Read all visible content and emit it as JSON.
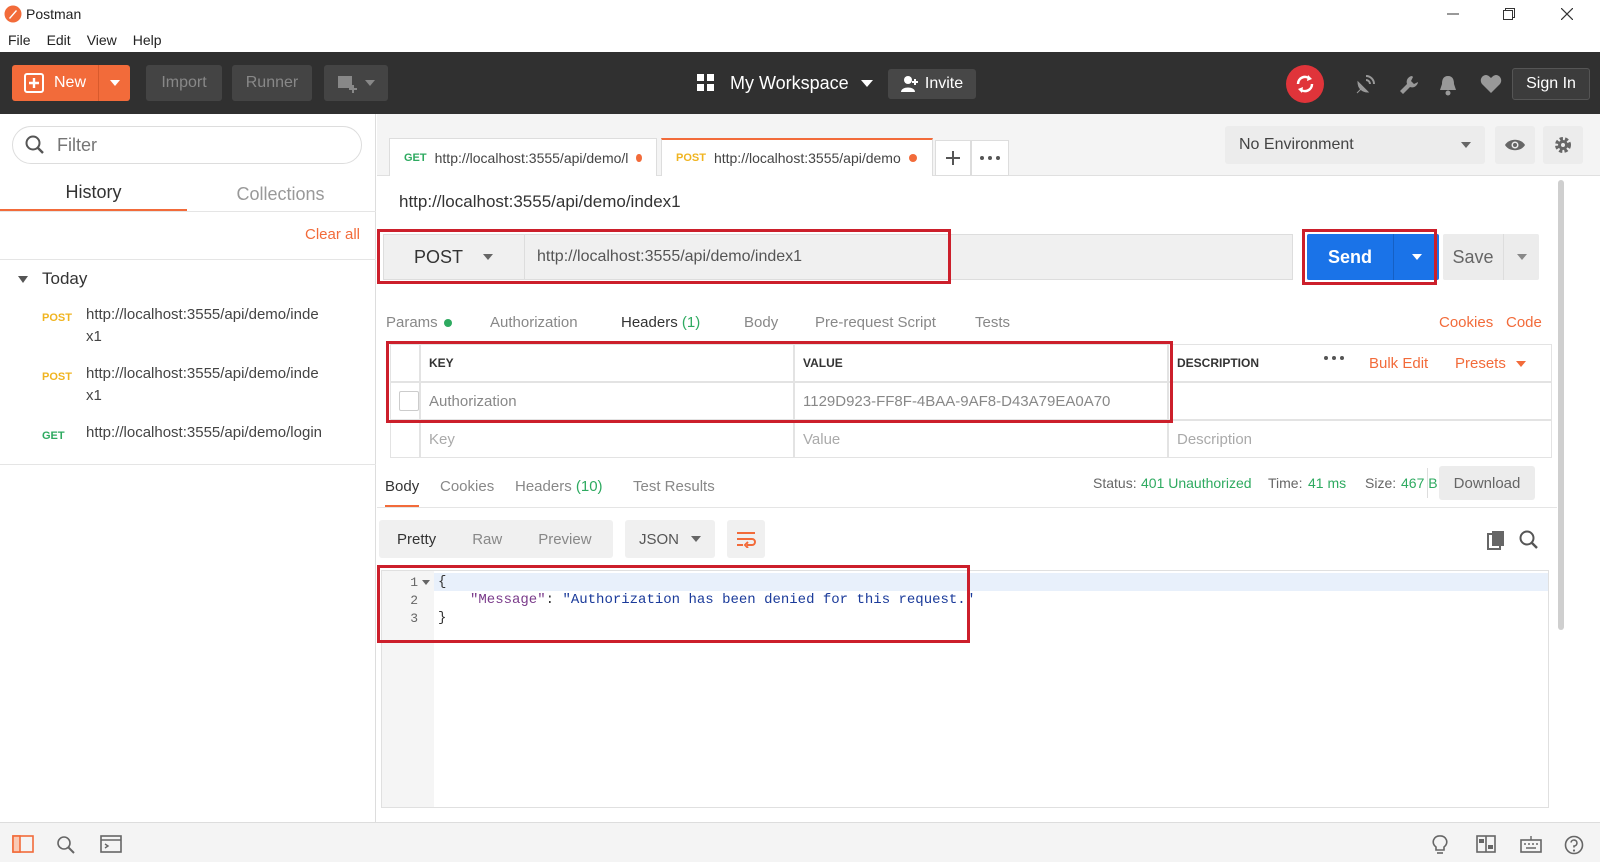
{
  "window": {
    "title": "Postman"
  },
  "menu": [
    "File",
    "Edit",
    "View",
    "Help"
  ],
  "header": {
    "new_label": "New",
    "import_label": "Import",
    "runner_label": "Runner",
    "workspace_label": "My Workspace",
    "invite_label": "Invite",
    "signin_label": "Sign In"
  },
  "sidebar": {
    "filter_placeholder": "Filter",
    "tabs": [
      "History",
      "Collections"
    ],
    "clear_all": "Clear all",
    "group_label": "Today",
    "history": [
      {
        "method": "POST",
        "url": "http://localhost:3555/api/demo/index1",
        "line1": "http://localhost:3555/api/demo/inde",
        "line2": "x1"
      },
      {
        "method": "POST",
        "url": "http://localhost:3555/api/demo/index1",
        "line1": "http://localhost:3555/api/demo/inde",
        "line2": "x1"
      },
      {
        "method": "GET",
        "url": "http://localhost:3555/api/demo/login",
        "line1": "http://localhost:3555/api/demo/login",
        "line2": ""
      }
    ]
  },
  "tabs": [
    {
      "method": "GET",
      "url": "http://localhost:3555/api/demo/l"
    },
    {
      "method": "POST",
      "url": "http://localhost:3555/api/demo"
    }
  ],
  "environment": {
    "selected": "No Environment"
  },
  "request": {
    "title": "http://localhost:3555/api/demo/index1",
    "method": "POST",
    "url": "http://localhost:3555/api/demo/index1",
    "send_label": "Send",
    "save_label": "Save",
    "subtabs": {
      "params": "Params",
      "authorization": "Authorization",
      "headers": "Headers",
      "headers_count": "(1)",
      "body": "Body",
      "prerequest": "Pre-request Script",
      "tests": "Tests"
    },
    "cookies_link": "Cookies",
    "code_link": "Code",
    "headers_table": {
      "col_key": "KEY",
      "col_value": "VALUE",
      "col_description": "DESCRIPTION",
      "bulk_edit": "Bulk Edit",
      "presets": "Presets",
      "rows": [
        {
          "key": "Authorization",
          "value": "1129D923-FF8F-4BAA-9AF8-D43A79EA0A70",
          "description": ""
        }
      ],
      "placeholder_key": "Key",
      "placeholder_value": "Value",
      "placeholder_description": "Description"
    }
  },
  "response": {
    "tabs": {
      "body": "Body",
      "cookies": "Cookies",
      "headers": "Headers",
      "headers_count": "(10)",
      "tests": "Test Results"
    },
    "status_label": "Status:",
    "status_value": "401 Unauthorized",
    "time_label": "Time:",
    "time_value": "41 ms",
    "size_label": "Size:",
    "size_value": "467 B",
    "download_label": "Download",
    "format_tabs": [
      "Pretty",
      "Raw",
      "Preview"
    ],
    "format_select": "JSON",
    "line_numbers": [
      "1",
      "2",
      "3"
    ],
    "code": {
      "open": "{",
      "key": "\"Message\"",
      "colon": ": ",
      "value": "\"Authorization has been denied for this request.\"",
      "close": "}"
    }
  },
  "colors": {
    "accent": "#f26b3a",
    "send": "#1a73e8",
    "highlight_box": "#cc1f2b",
    "success_green": "#2eaa60",
    "header_bg": "#303030"
  }
}
